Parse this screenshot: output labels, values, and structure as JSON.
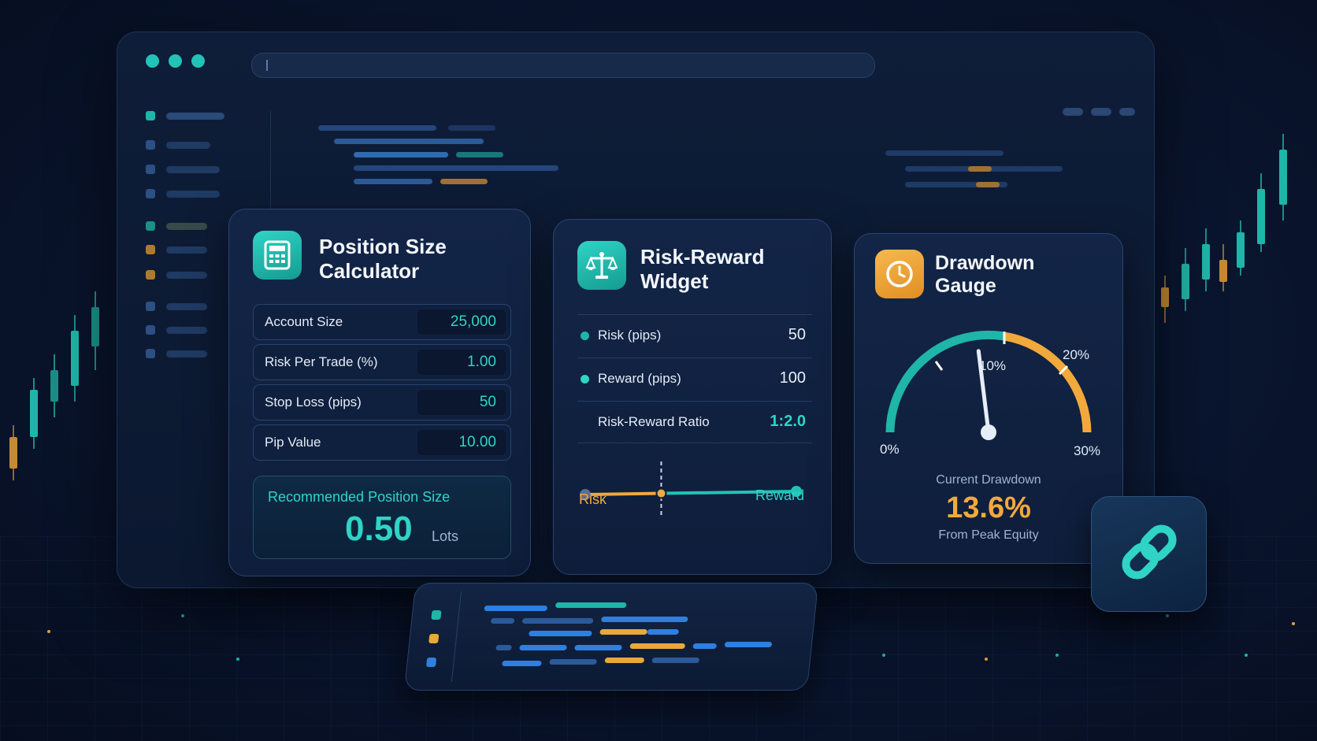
{
  "colors": {
    "teal": "#21c3b6",
    "orange": "#f2a93b",
    "card_bg": "#132547",
    "background": "#0a1630"
  },
  "position_size_calculator": {
    "icon": "calculator-icon",
    "title_line1": "Position Size",
    "title_line2": "Calculator",
    "fields": [
      {
        "label": "Account Size",
        "value": "25,000"
      },
      {
        "label": "Risk Per Trade (%)",
        "value": "1.00"
      },
      {
        "label": "Stop Loss (pips)",
        "value": "50"
      },
      {
        "label": "Pip Value",
        "value": "10.00"
      }
    ],
    "result_label": "Recommended Position Size",
    "result_value": "0.50",
    "result_unit": "Lots"
  },
  "risk_reward_widget": {
    "icon": "scales-icon",
    "title_line1": "Risk-Reward",
    "title_line2": "Widget",
    "rows": [
      {
        "label": "Risk (pips)",
        "value": "50"
      },
      {
        "label": "Reward (pips)",
        "value": "100"
      },
      {
        "label": "Risk-Reward Ratio",
        "value": "1:2.0"
      }
    ],
    "slider_left_label": "Risk",
    "slider_right_label": "Reward",
    "slider_marker_fraction": 0.36
  },
  "drawdown_gauge": {
    "icon": "clock-icon",
    "title_line1": "Drawdown",
    "title_line2": "Gauge",
    "ticks": [
      "0%",
      "10%",
      "20%",
      "30%"
    ],
    "needle_value_percent": 13.6,
    "caption": "Current Drawdown",
    "value": "13.6%",
    "subcaption": "From Peak Equity"
  },
  "link_tile": {
    "icon": "link-icon"
  }
}
